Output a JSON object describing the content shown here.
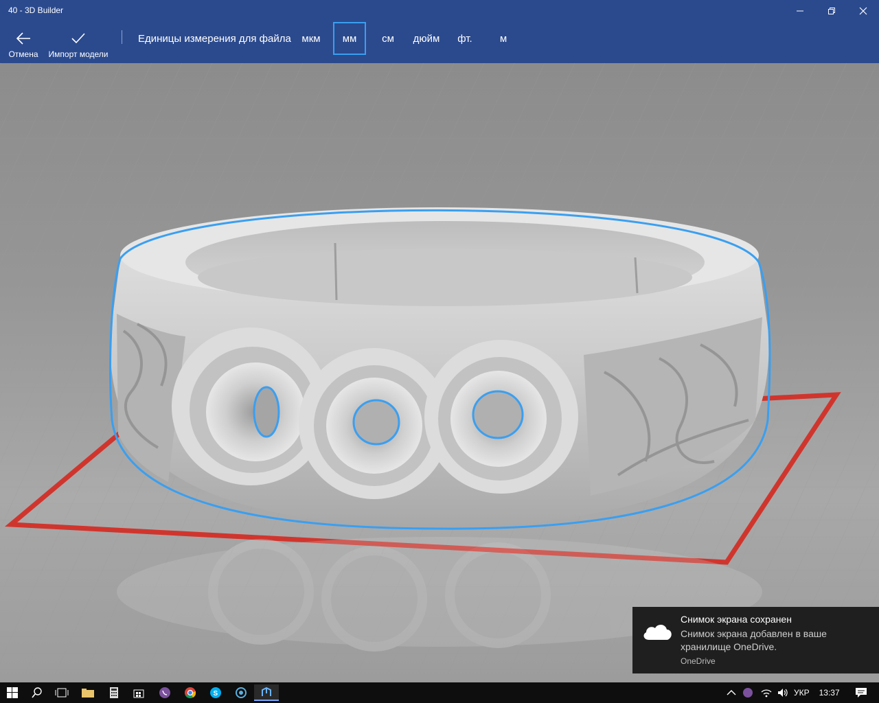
{
  "window": {
    "title": "40 - 3D Builder"
  },
  "toolbar": {
    "cancel_label": "Отмена",
    "import_label": "Импорт модели",
    "units_label": "Единицы измерения для файла",
    "units": [
      "мкм",
      "мм",
      "см",
      "дюйм",
      "фт.",
      "м"
    ],
    "selected_unit": "мм"
  },
  "toast": {
    "title": "Снимок экрана сохранен",
    "body": "Снимок экрана добавлен в ваше хранилище OneDrive.",
    "source": "OneDrive"
  },
  "taskbar": {
    "language": "УКР",
    "time": "13:37"
  },
  "colors": {
    "accent_bar": "#2b4a8e",
    "selection_outline": "#3a9ff0",
    "build_plate": "#d0352d"
  }
}
